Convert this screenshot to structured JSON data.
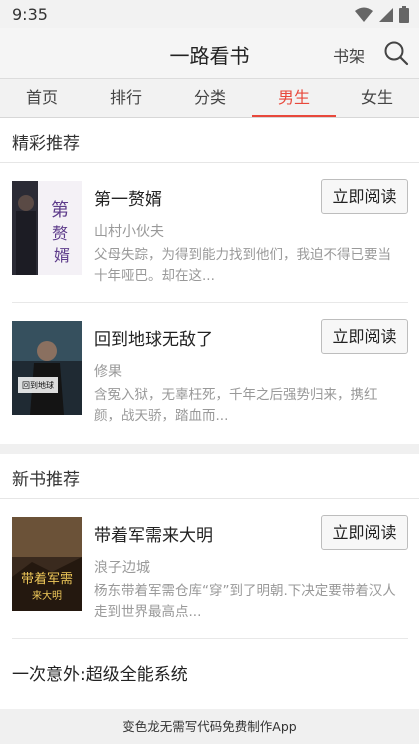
{
  "status_bar": {
    "time": "9:35"
  },
  "header": {
    "title": "一路看书",
    "shelf_label": "书架"
  },
  "tabs": [
    {
      "label": "首页"
    },
    {
      "label": "排行"
    },
    {
      "label": "分类"
    },
    {
      "label": "男生",
      "active": true
    },
    {
      "label": "女生"
    }
  ],
  "sections": [
    {
      "title": "精彩推荐",
      "books": [
        {
          "name": "第一赘婿",
          "author": "山村小伙夫",
          "desc": "父母失踪，为得到能力找到他们，我迫不得已要当十年哑巴。却在这...",
          "button": "立即阅读"
        },
        {
          "name": "回到地球无敌了",
          "author": "修果",
          "desc": "含冤入狱，无辜枉死，千年之后强势归来，携红颜，战天骄，踏血而...",
          "button": "立即阅读"
        }
      ]
    },
    {
      "title": "新书推荐",
      "books": [
        {
          "name": "带着军需来大明",
          "author": "浪子边城",
          "desc": "杨东带着军需仓库“穿”到了明朝.下决定要带着汉人走到世界最高点...",
          "button": "立即阅读"
        }
      ],
      "list": [
        "一次意外:超级全能系统"
      ]
    }
  ],
  "footer": {
    "text": "变色龙无需写代码免费制作App"
  },
  "colors": {
    "accent": "#e8483b",
    "background": "#ffffff",
    "muted_text": "#999999"
  }
}
